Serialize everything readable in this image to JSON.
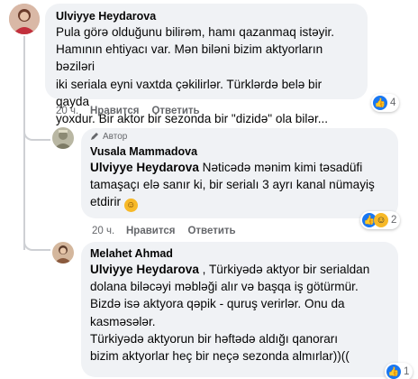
{
  "comments": [
    {
      "author": "Ulviyye Heydarova",
      "text": "Pula görə olduğunu bilirəm, hamı qazanmaq istəyir.\nHamının ehtiyacı var. Mən biləni bizim aktyorların bəziləri\niki seriala eyni vaxtda çəkilirlər. Türklərdə belə bir qayda\nyoxdur. Bir aktor bir sezonda bir \"dizidə\" ola bilər...",
      "time": "20 ч.",
      "like_label": "Нравится",
      "reply_label": "Ответить",
      "reaction_count": "4"
    },
    {
      "badge": "Автор",
      "author": "Vusala Mammadova",
      "mention": "Ulviyye Heydarova",
      "text": " Nəticədə mənim kimi təsadüfi\ntamaşaçı elə sanır ki, bir serialı 3 ayrı kanal nümayiş\netdirir ",
      "emoji": "smile-emoji",
      "time": "20 ч.",
      "like_label": "Нравится",
      "reply_label": "Ответить",
      "reaction_count": "2"
    },
    {
      "author": "Melahet Ahmad",
      "mention": "Ulviyye Heydarova",
      "text": " , Türkiyədə aktyor bir serialdan\ndolana biləcəyi məbləği alır və başqa iş götürmür.\nBizdə isə aktyora qəpik - quruş verirlər. Onu da\nkasməsələr.\nTürkiyədə aktyorun bir həftədə aldığı qanorarı\nbizim aktyorlar heç bir neçə sezonda almırlar))((",
      "reaction_count": "1"
    }
  ],
  "colors": {
    "like": "#1877f2",
    "haha": "#f7b928",
    "bubble": "#f0f2f5",
    "meta": "#65676b"
  }
}
